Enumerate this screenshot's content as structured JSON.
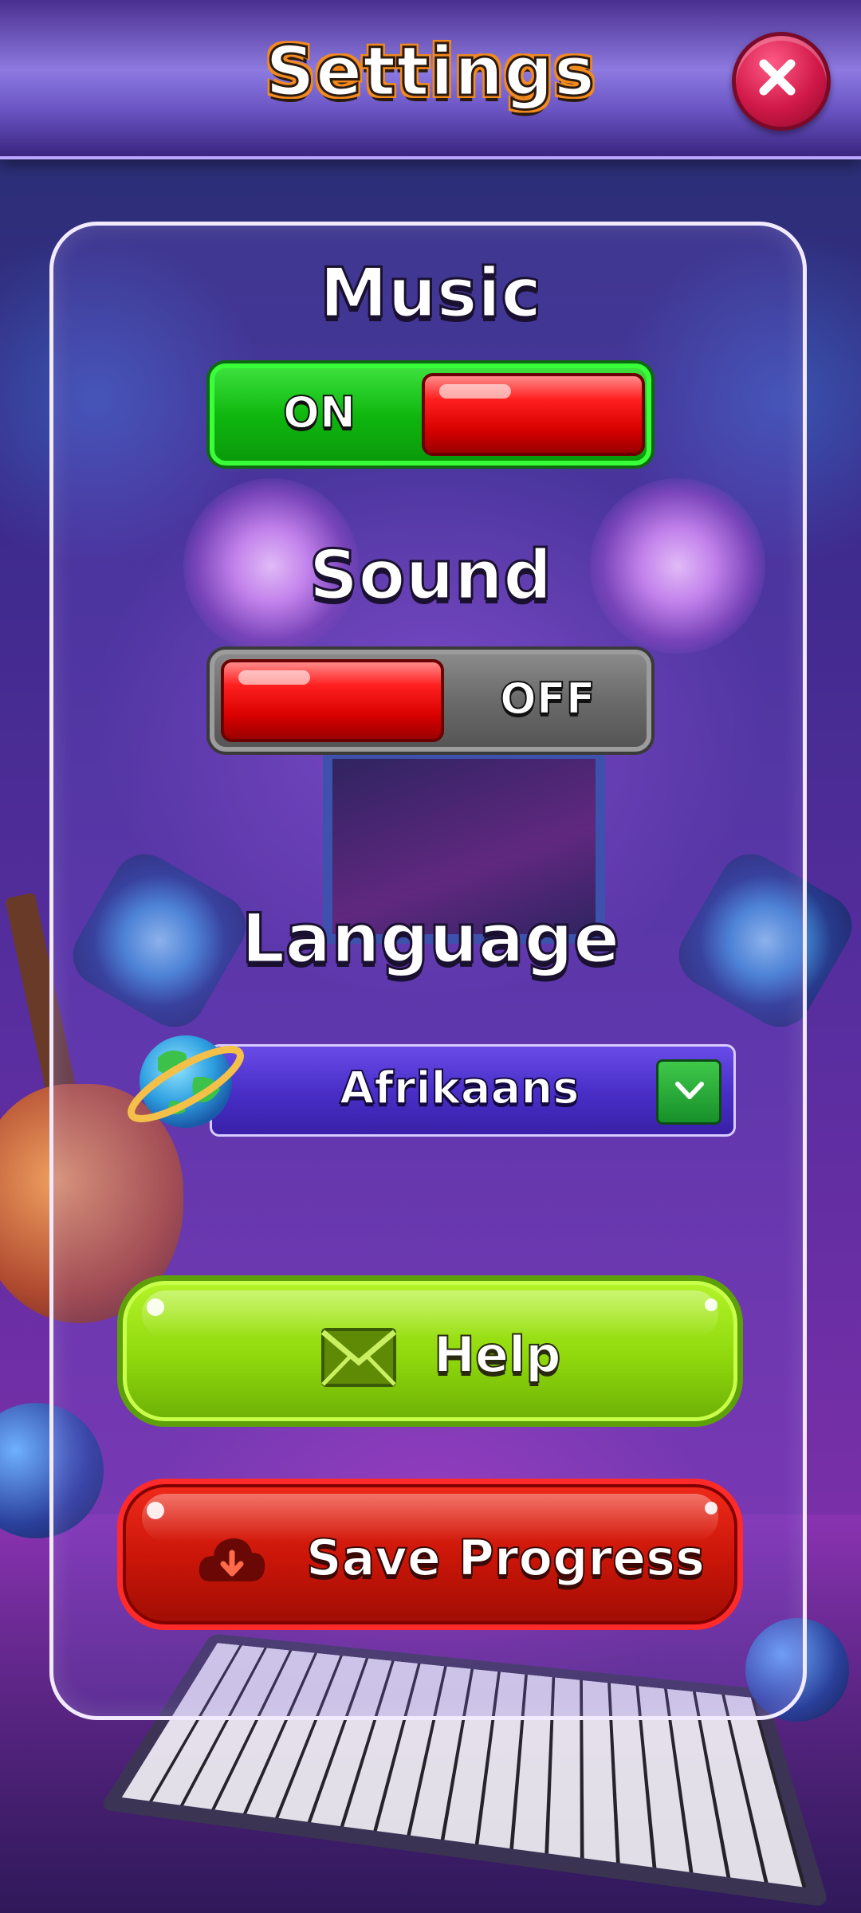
{
  "header": {
    "title": "Settings",
    "close_icon": "close-icon"
  },
  "music": {
    "label": "Music",
    "state": "ON",
    "enabled": true
  },
  "sound": {
    "label": "Sound",
    "state": "OFF",
    "enabled": false
  },
  "language": {
    "label": "Language",
    "selected": "Afrikaans",
    "globe_icon": "globe-icon",
    "dropdown_icon": "chevron-down-icon"
  },
  "buttons": {
    "help": {
      "label": "Help",
      "icon": "mail-icon"
    },
    "save": {
      "label": "Save Progress",
      "icon": "cloud-download-icon"
    }
  },
  "colors": {
    "title_outline": "#f28a1f",
    "toggle_on": "#17c817",
    "toggle_off": "#6a6a6a",
    "knob": "#e00000",
    "help_button": "#9ad80c",
    "save_button": "#d01508",
    "close_button": "#d01848"
  }
}
